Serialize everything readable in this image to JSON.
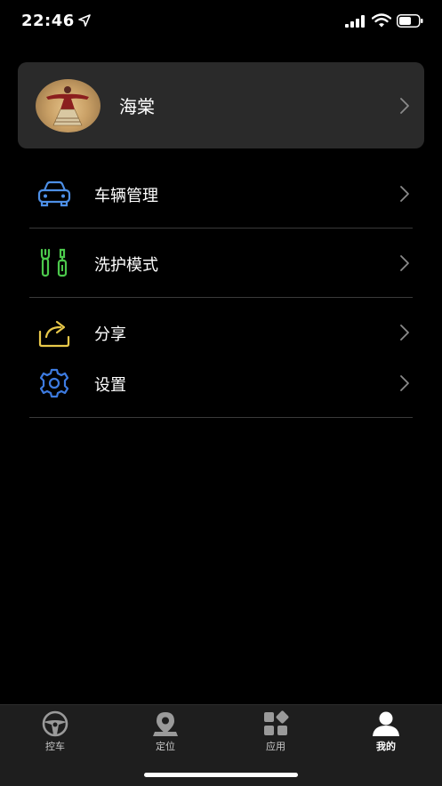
{
  "status_bar": {
    "time": "22:46",
    "icons": [
      "location-arrow-icon",
      "signal-icon",
      "wifi-icon",
      "battery-icon"
    ]
  },
  "profile": {
    "name": "海棠",
    "avatar": "avatar-photo"
  },
  "menu": [
    {
      "id": "vehicle-management",
      "label": "车辆管理",
      "icon": "car-icon",
      "icon_color": "#4d8fe6"
    },
    {
      "id": "wash-care-mode",
      "label": "洗护模式",
      "icon": "tools-icon",
      "icon_color": "#4cc94c"
    },
    {
      "id": "share",
      "label": "分享",
      "icon": "share-icon",
      "icon_color": "#e8c84a"
    },
    {
      "id": "settings",
      "label": "设置",
      "icon": "gear-icon",
      "icon_color": "#3d7be0"
    }
  ],
  "tabbar": {
    "tabs": [
      {
        "id": "control-car",
        "label": "控车",
        "icon": "steering-wheel-icon",
        "active": false
      },
      {
        "id": "location",
        "label": "定位",
        "icon": "map-pin-icon",
        "active": false
      },
      {
        "id": "apps",
        "label": "应用",
        "icon": "apps-grid-icon",
        "active": false
      },
      {
        "id": "mine",
        "label": "我的",
        "icon": "person-icon",
        "active": true
      }
    ]
  },
  "colors": {
    "background": "#000000",
    "card": "#2a2a2a",
    "tabbar": "#1e1e1e",
    "divider": "#3a3a3a",
    "chevron": "#8a8a8a"
  }
}
